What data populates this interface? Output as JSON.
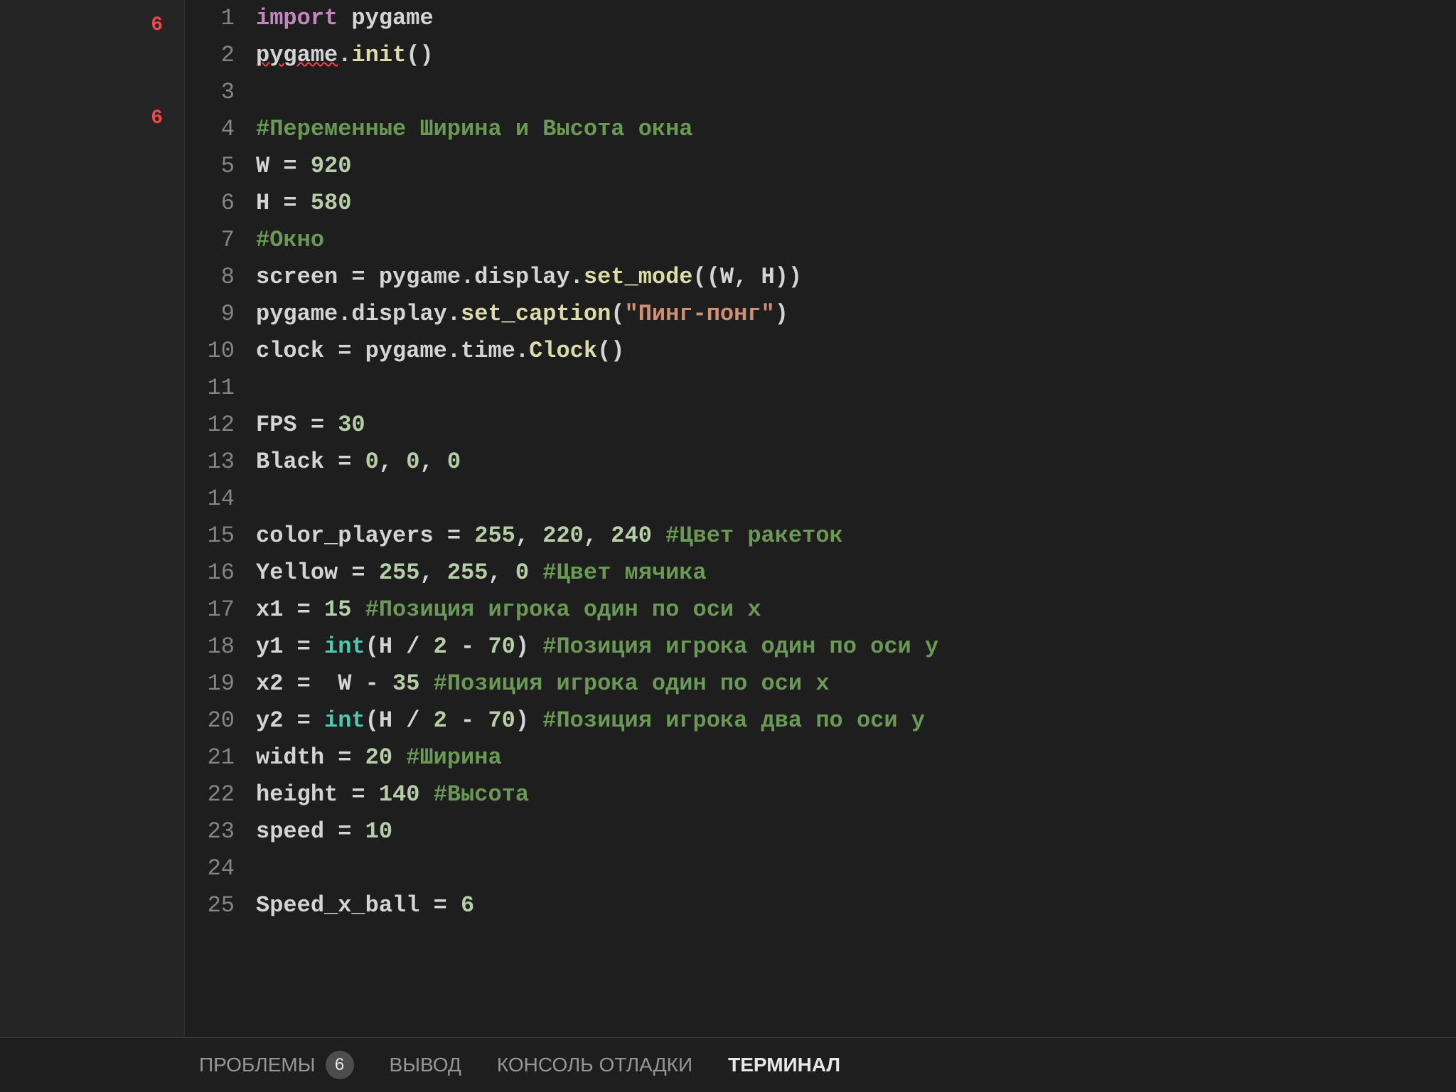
{
  "sidebar": {
    "badge1": "6",
    "badge2": "6"
  },
  "lines": [
    {
      "n": "1",
      "tokens": [
        [
          "import ",
          "keyword"
        ],
        [
          "pygame",
          "module"
        ]
      ]
    },
    {
      "n": "2",
      "tokens": [
        [
          "pygame",
          "module squiggle"
        ],
        [
          ".",
          "op"
        ],
        [
          "init",
          "func"
        ],
        [
          "()",
          "op"
        ]
      ]
    },
    {
      "n": "3",
      "tokens": []
    },
    {
      "n": "4",
      "tokens": [
        [
          "#Переменные Ширина и Высота окна",
          "comment"
        ]
      ]
    },
    {
      "n": "5",
      "tokens": [
        [
          "W ",
          "var"
        ],
        [
          "= ",
          "op"
        ],
        [
          "920",
          "num"
        ]
      ]
    },
    {
      "n": "6",
      "tokens": [
        [
          "H ",
          "var"
        ],
        [
          "= ",
          "op"
        ],
        [
          "580",
          "num"
        ]
      ]
    },
    {
      "n": "7",
      "tokens": [
        [
          "#Окно",
          "comment"
        ]
      ]
    },
    {
      "n": "8",
      "tokens": [
        [
          "screen ",
          "var"
        ],
        [
          "= ",
          "op"
        ],
        [
          "pygame",
          "module"
        ],
        [
          ".",
          "op"
        ],
        [
          "display",
          "module"
        ],
        [
          ".",
          "op"
        ],
        [
          "set_mode",
          "func"
        ],
        [
          "((W, H))",
          "op"
        ]
      ]
    },
    {
      "n": "9",
      "tokens": [
        [
          "pygame",
          "module"
        ],
        [
          ".",
          "op"
        ],
        [
          "display",
          "module"
        ],
        [
          ".",
          "op"
        ],
        [
          "set_caption",
          "func"
        ],
        [
          "(",
          "op"
        ],
        [
          "\"Пинг-понг\"",
          "str"
        ],
        [
          ")",
          "op"
        ]
      ]
    },
    {
      "n": "10",
      "tokens": [
        [
          "clock ",
          "var"
        ],
        [
          "= ",
          "op"
        ],
        [
          "pygame",
          "module"
        ],
        [
          ".",
          "op"
        ],
        [
          "time",
          "module"
        ],
        [
          ".",
          "op"
        ],
        [
          "Clock",
          "func"
        ],
        [
          "()",
          "op"
        ]
      ]
    },
    {
      "n": "11",
      "tokens": []
    },
    {
      "n": "12",
      "tokens": [
        [
          "FPS ",
          "var"
        ],
        [
          "= ",
          "op"
        ],
        [
          "30",
          "num"
        ]
      ]
    },
    {
      "n": "13",
      "tokens": [
        [
          "Black ",
          "var"
        ],
        [
          "= ",
          "op"
        ],
        [
          "0",
          "num"
        ],
        [
          ", ",
          "op"
        ],
        [
          "0",
          "num"
        ],
        [
          ", ",
          "op"
        ],
        [
          "0",
          "num"
        ]
      ]
    },
    {
      "n": "14",
      "tokens": []
    },
    {
      "n": "15",
      "tokens": [
        [
          "color_players ",
          "var"
        ],
        [
          "= ",
          "op"
        ],
        [
          "255",
          "num"
        ],
        [
          ", ",
          "op"
        ],
        [
          "220",
          "num"
        ],
        [
          ", ",
          "op"
        ],
        [
          "240",
          "num"
        ],
        [
          " ",
          "op"
        ],
        [
          "#Цвет ракеток",
          "comment"
        ]
      ]
    },
    {
      "n": "16",
      "tokens": [
        [
          "Yellow ",
          "var"
        ],
        [
          "= ",
          "op"
        ],
        [
          "255",
          "num"
        ],
        [
          ", ",
          "op"
        ],
        [
          "255",
          "num"
        ],
        [
          ", ",
          "op"
        ],
        [
          "0",
          "num"
        ],
        [
          " ",
          "op"
        ],
        [
          "#Цвет мячика",
          "comment"
        ]
      ]
    },
    {
      "n": "17",
      "tokens": [
        [
          "x1 ",
          "var"
        ],
        [
          "= ",
          "op"
        ],
        [
          "15",
          "num"
        ],
        [
          " ",
          "op"
        ],
        [
          "#Позиция игрока один по оси х",
          "comment"
        ]
      ]
    },
    {
      "n": "18",
      "tokens": [
        [
          "y1 ",
          "var"
        ],
        [
          "= ",
          "op"
        ],
        [
          "int",
          "type"
        ],
        [
          "(H / ",
          "op"
        ],
        [
          "2",
          "num"
        ],
        [
          " - ",
          "op"
        ],
        [
          "70",
          "num"
        ],
        [
          ") ",
          "op"
        ],
        [
          "#Позиция игрока один по оси у",
          "comment"
        ]
      ]
    },
    {
      "n": "19",
      "tokens": [
        [
          "x2 ",
          "var"
        ],
        [
          "=  ",
          "op"
        ],
        [
          "W - ",
          "var"
        ],
        [
          "35",
          "num"
        ],
        [
          " ",
          "op"
        ],
        [
          "#Позиция игрока один по оси х",
          "comment"
        ]
      ]
    },
    {
      "n": "20",
      "tokens": [
        [
          "y2 ",
          "var"
        ],
        [
          "= ",
          "op"
        ],
        [
          "int",
          "type"
        ],
        [
          "(H / ",
          "op"
        ],
        [
          "2",
          "num"
        ],
        [
          " - ",
          "op"
        ],
        [
          "70",
          "num"
        ],
        [
          ") ",
          "op"
        ],
        [
          "#Позиция игрока два по оси у",
          "comment"
        ]
      ]
    },
    {
      "n": "21",
      "tokens": [
        [
          "width ",
          "var"
        ],
        [
          "= ",
          "op"
        ],
        [
          "20",
          "num"
        ],
        [
          " ",
          "op"
        ],
        [
          "#Ширина",
          "comment"
        ]
      ]
    },
    {
      "n": "22",
      "tokens": [
        [
          "height ",
          "var"
        ],
        [
          "= ",
          "op"
        ],
        [
          "140",
          "num"
        ],
        [
          " ",
          "op"
        ],
        [
          "#Высота",
          "comment"
        ]
      ]
    },
    {
      "n": "23",
      "tokens": [
        [
          "speed ",
          "var"
        ],
        [
          "= ",
          "op"
        ],
        [
          "10",
          "num"
        ]
      ]
    },
    {
      "n": "24",
      "tokens": []
    },
    {
      "n": "25",
      "tokens": [
        [
          "Speed_x_ball ",
          "var"
        ],
        [
          "= ",
          "op"
        ],
        [
          "6",
          "num"
        ]
      ]
    }
  ],
  "panel": {
    "problems_label": "ПРОБЛЕМЫ",
    "problems_count": "6",
    "output_label": "ВЫВОД",
    "debug_console_label": "КОНСОЛЬ ОТЛАДКИ",
    "terminal_label": "ТЕРМИНАЛ"
  }
}
